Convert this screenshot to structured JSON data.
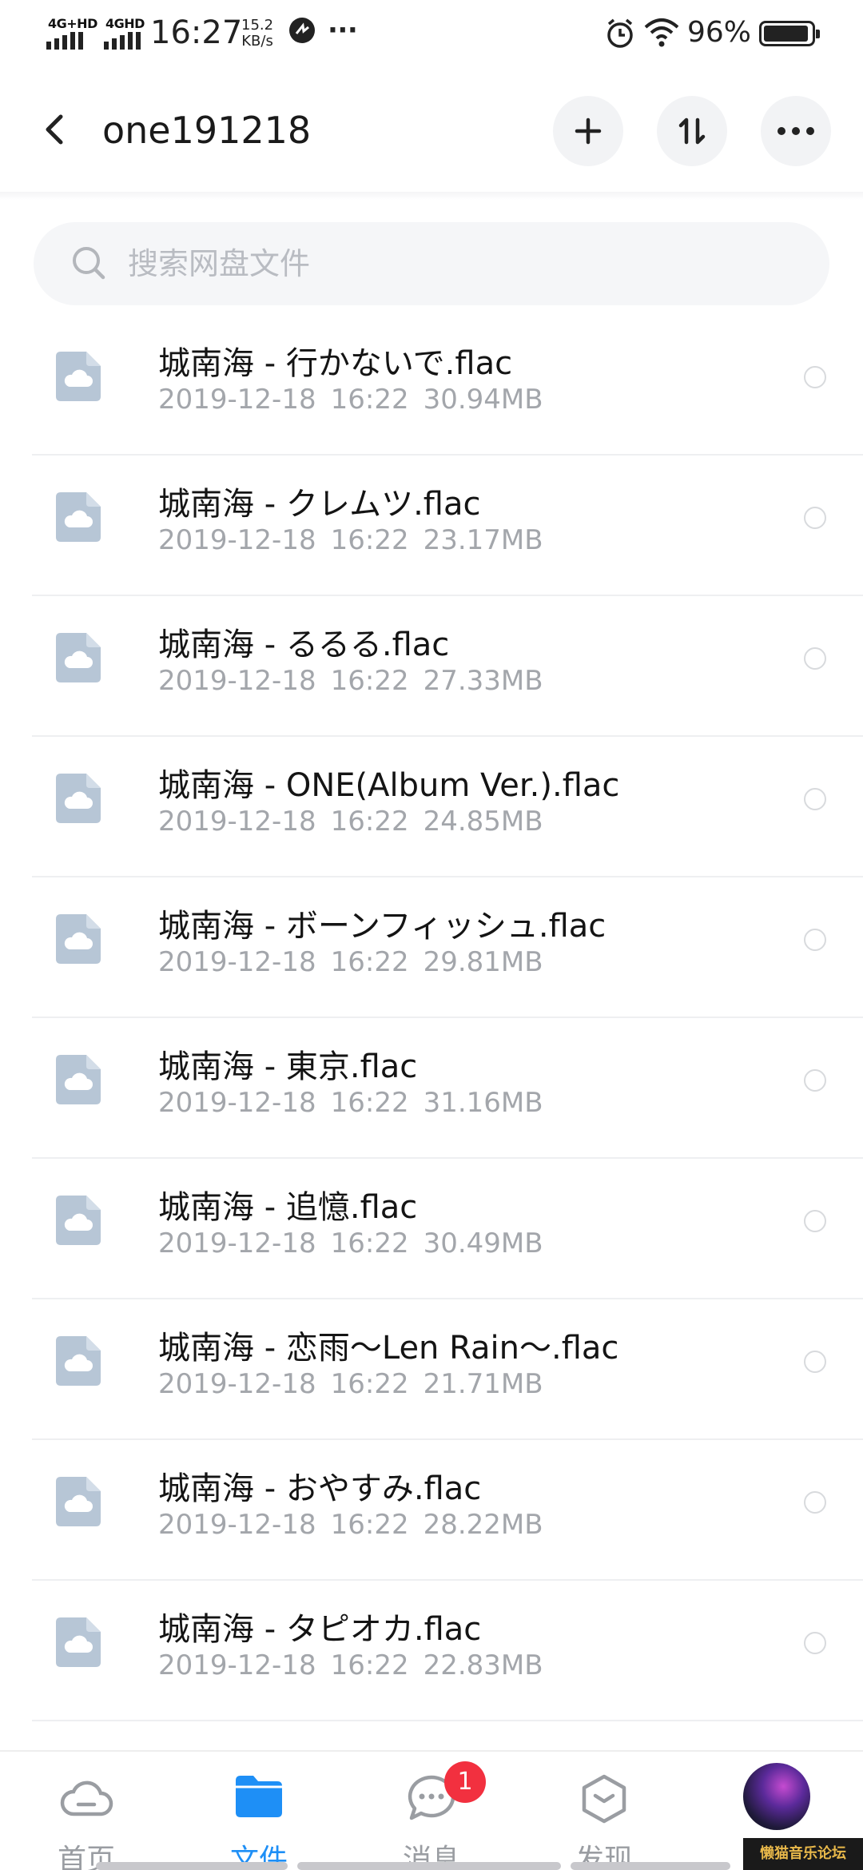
{
  "status_bar": {
    "network1": "4G+HD",
    "network2": "4GHD",
    "time": "16:27",
    "speed_value": "15.2",
    "speed_unit": "KB/s",
    "more": "···",
    "battery": "96%"
  },
  "header": {
    "title": "one191218"
  },
  "search": {
    "placeholder": "搜索网盘文件"
  },
  "files": [
    {
      "name": "城南海 - 行かないで.flac",
      "date": "2019-12-18",
      "time": "16:22",
      "size": "30.94MB"
    },
    {
      "name": "城南海 - クレムツ.flac",
      "date": "2019-12-18",
      "time": "16:22",
      "size": "23.17MB"
    },
    {
      "name": "城南海 - るるる.flac",
      "date": "2019-12-18",
      "time": "16:22",
      "size": "27.33MB"
    },
    {
      "name": "城南海 - ONE(Album Ver.).flac",
      "date": "2019-12-18",
      "time": "16:22",
      "size": "24.85MB"
    },
    {
      "name": "城南海 - ボーンフィッシュ.flac",
      "date": "2019-12-18",
      "time": "16:22",
      "size": "29.81MB"
    },
    {
      "name": "城南海 - 東京.flac",
      "date": "2019-12-18",
      "time": "16:22",
      "size": "31.16MB"
    },
    {
      "name": "城南海 - 追憶.flac",
      "date": "2019-12-18",
      "time": "16:22",
      "size": "30.49MB"
    },
    {
      "name": "城南海 - 恋雨～Len Rain～.flac",
      "date": "2019-12-18",
      "time": "16:22",
      "size": "21.71MB"
    },
    {
      "name": "城南海 - おやすみ.flac",
      "date": "2019-12-18",
      "time": "16:22",
      "size": "28.22MB"
    },
    {
      "name": "城南海 - タピオカ.flac",
      "date": "2019-12-18",
      "time": "16:22",
      "size": "22.83MB"
    }
  ],
  "bottom_nav": {
    "home": "首页",
    "files": "文件",
    "messages": "消息",
    "messages_badge": "1",
    "discover": "发现"
  },
  "watermark": "懒猫音乐论坛",
  "colors": {
    "accent": "#1e8ff6",
    "badge": "#f2303f",
    "file_icon": "#b7c6d6",
    "meta_text": "#a3a6ab"
  }
}
